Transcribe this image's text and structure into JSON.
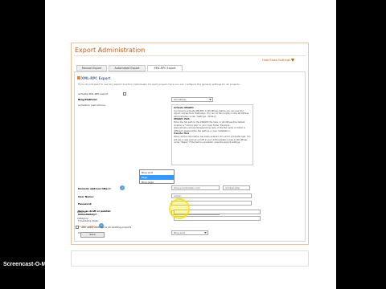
{
  "watermark": "Screencast-O-Matic.com",
  "panel": {
    "title": "Export Administration",
    "link": "Hide/Show Settings"
  },
  "tabs": [
    "Manual Export",
    "Automated Export",
    "XML-RPC Export"
  ],
  "section": {
    "title": "XML-RPC Export",
    "hint": "If you do not want to use any export function individually for each project, here you can configure the general settings for all projects."
  },
  "fields": {
    "activate_label": "Activate XML-RPC export",
    "platform_label": "Blog/Platform:",
    "platform_value": "WordPress",
    "activation_label": "Activation Instructions:",
    "url_label": "Domain/ address http://:",
    "url_value": "blog.yourdomain.com",
    "url_suffix": "/xmlrpc.php",
    "user_label": "User Name:",
    "user_value": "admin",
    "password_label": "Password:",
    "publish_label": "Save as draft or publish immediately?:",
    "publish_value": "Draft",
    "timestamp_label": "Timestamp Date:",
    "options_label": "Further options",
    "format_label": "Publish as:",
    "format_value": "Blog post",
    "blogid_label": "Blog ID:",
    "category_label": "Category:",
    "apply_label": "also apply settings to all existing projects",
    "save_button": "Save"
  },
  "infobox": {
    "h1": "Activate XMLRPC",
    "p1": "You have to activate XMLRPC in WordPress before you can use it to import entries from Textbroker. You can do this quickly in the WordPress administration under \"Settings - Writing\".",
    "h2": "XMLRPC Path",
    "p2": "Enter the full path to the XMLRPC file here. In WordPress the default location is \"xmlrpc.php\" in your main folder. Example: www.domain.com/wordpress/xmlrpc.php. If the file name or folder is different, please enter the path as in your installation.",
    "h3": "Transfer Test",
    "p3": "When all the information has been entered, fill out for a transfer test. You will see a new post as a draft in your administration area in WordPress under \"Pages\" if the test is successful; save the export settings."
  },
  "dropdown": [
    "Blog post",
    "Page",
    "Blog page"
  ]
}
